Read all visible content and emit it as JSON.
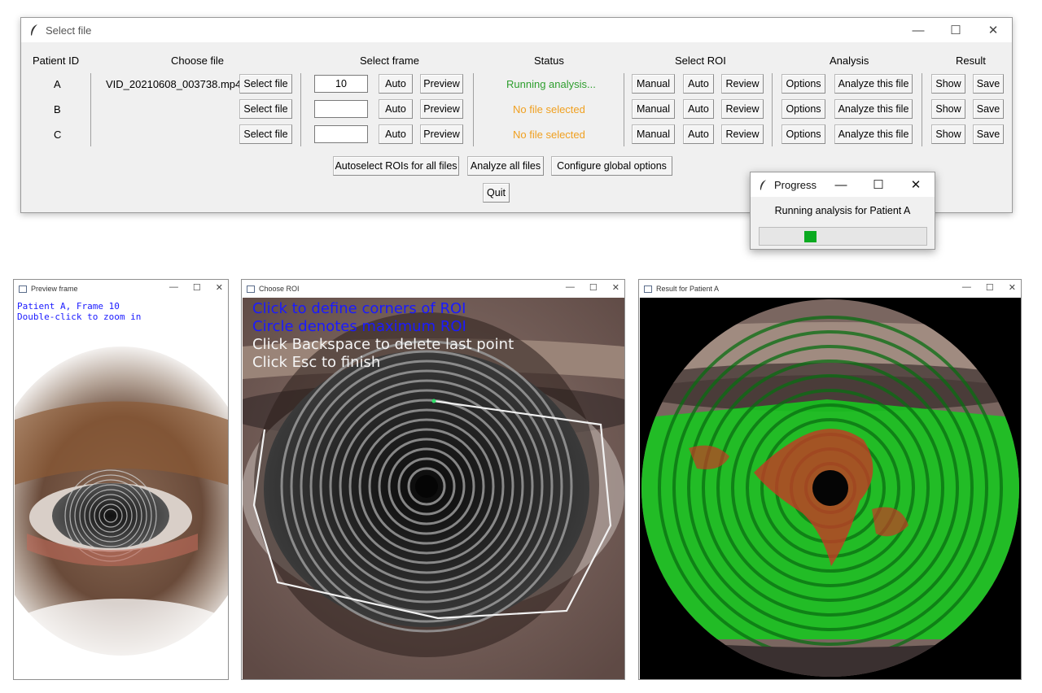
{
  "main_window": {
    "title": "Select file",
    "headers": {
      "patient_id": "Patient ID",
      "choose_file": "Choose file",
      "select_frame": "Select frame",
      "status": "Status",
      "select_roi": "Select ROI",
      "analysis": "Analysis",
      "result": "Result"
    },
    "rows": [
      {
        "id": "A",
        "file": "VID_20210608_003738.mp4",
        "frame": "10",
        "status": "Running analysis..."
      },
      {
        "id": "B",
        "file": "",
        "frame": "",
        "status": "No file selected"
      },
      {
        "id": "C",
        "file": "",
        "frame": "",
        "status": "No file selected"
      }
    ],
    "buttons": {
      "select_file": "Select file",
      "auto": "Auto",
      "preview": "Preview",
      "manual": "Manual",
      "review": "Review",
      "options": "Options",
      "analyze_this": "Analyze this file",
      "show": "Show",
      "save": "Save",
      "autoselect_all": "Autoselect ROIs for all files",
      "analyze_all": "Analyze all files",
      "configure_global": "Configure global options",
      "quit": "Quit"
    },
    "colors": {
      "running": "#2e9e2e",
      "none": "#f0a020"
    }
  },
  "progress_window": {
    "title": "Progress",
    "message": "Running analysis for Patient A",
    "progress_fraction": 0.06,
    "bar_color": "#0aaa20"
  },
  "preview_window": {
    "title": "Preview frame",
    "line1": "Patient A, Frame 10",
    "line2": "Double-click to zoom in"
  },
  "roi_window": {
    "title": "Choose ROI",
    "line1": "Click to define corners of ROI",
    "line2": "Circle denotes maximum ROI",
    "line3": "Click Backspace to delete last point",
    "line4": "Click Esc to finish"
  },
  "result_window": {
    "title": "Result for Patient A"
  }
}
